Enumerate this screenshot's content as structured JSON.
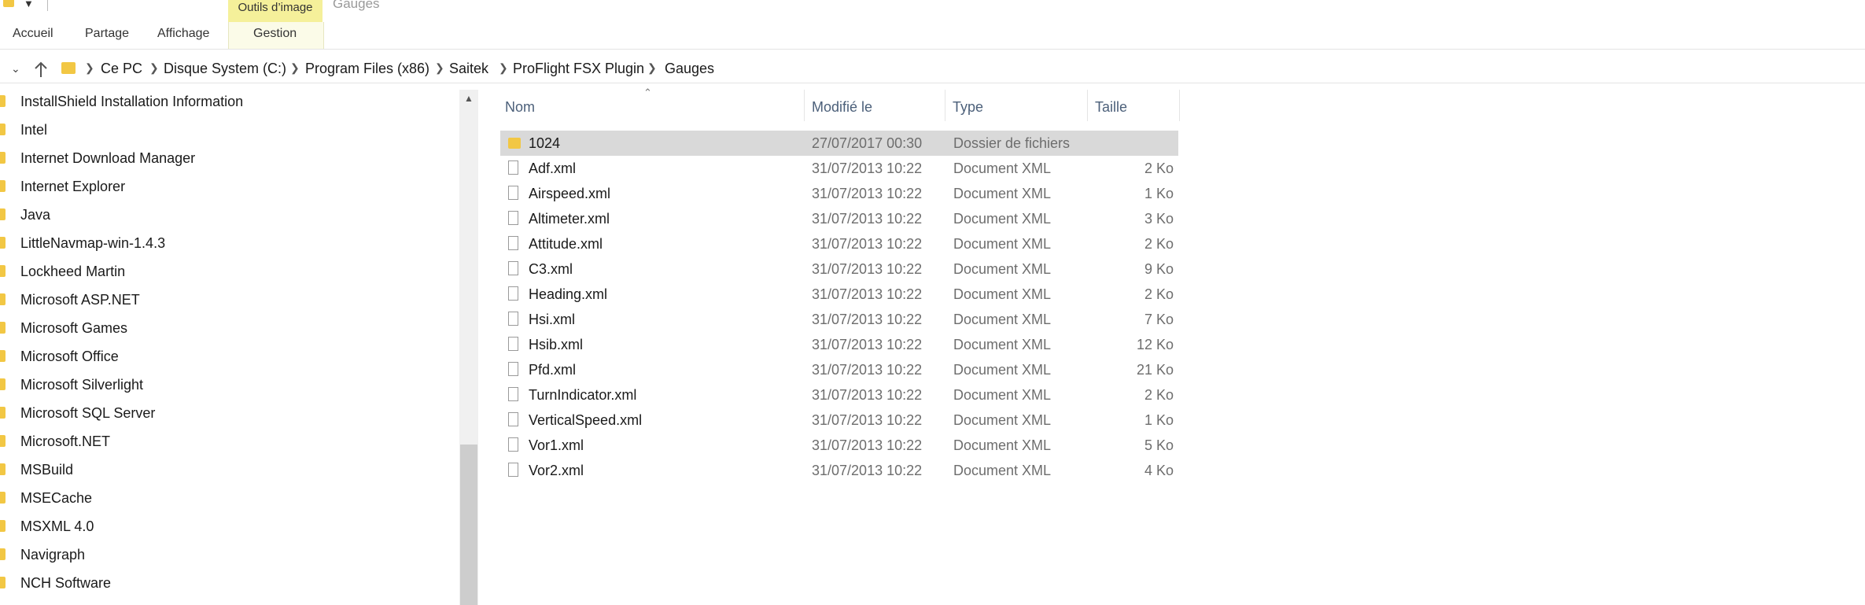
{
  "ribbon": {
    "context_header": "Outils d’image",
    "app_title": "Gauges",
    "tabs": [
      "Accueil",
      "Partage",
      "Affichage",
      "Gestion"
    ]
  },
  "address": {
    "crumbs": [
      "Ce PC",
      "Disque System (C:)",
      "Program Files (x86)",
      "Saitek",
      "ProFlight FSX Plugin",
      "Gauges"
    ]
  },
  "tree": {
    "items": [
      "InstallShield Installation Information",
      "Intel",
      "Internet Download Manager",
      "Internet Explorer",
      "Java",
      "LittleNavmap-win-1.4.3",
      "Lockheed Martin",
      "Microsoft ASP.NET",
      "Microsoft Games",
      "Microsoft Office",
      "Microsoft Silverlight",
      "Microsoft SQL Server",
      "Microsoft.NET",
      "MSBuild",
      "MSECache",
      "MSXML 4.0",
      "Navigraph",
      "NCH Software"
    ]
  },
  "columns": {
    "name": "Nom",
    "modified": "Modifié le",
    "type": "Type",
    "size": "Taille"
  },
  "files": [
    {
      "name": "1024",
      "modified": "27/07/2017 00:30",
      "type": "Dossier de fichiers",
      "size": "",
      "icon": "folder-icon",
      "selected": true
    },
    {
      "name": "Adf.xml",
      "modified": "31/07/2013 10:22",
      "type": "Document XML",
      "size": "2 Ko",
      "icon": "file-icon"
    },
    {
      "name": "Airspeed.xml",
      "modified": "31/07/2013 10:22",
      "type": "Document XML",
      "size": "1 Ko",
      "icon": "file-icon"
    },
    {
      "name": "Altimeter.xml",
      "modified": "31/07/2013 10:22",
      "type": "Document XML",
      "size": "3 Ko",
      "icon": "file-icon"
    },
    {
      "name": "Attitude.xml",
      "modified": "31/07/2013 10:22",
      "type": "Document XML",
      "size": "2 Ko",
      "icon": "file-icon"
    },
    {
      "name": "C3.xml",
      "modified": "31/07/2013 10:22",
      "type": "Document XML",
      "size": "9 Ko",
      "icon": "file-icon"
    },
    {
      "name": "Heading.xml",
      "modified": "31/07/2013 10:22",
      "type": "Document XML",
      "size": "2 Ko",
      "icon": "file-icon"
    },
    {
      "name": "Hsi.xml",
      "modified": "31/07/2013 10:22",
      "type": "Document XML",
      "size": "7 Ko",
      "icon": "file-icon"
    },
    {
      "name": "Hsib.xml",
      "modified": "31/07/2013 10:22",
      "type": "Document XML",
      "size": "12 Ko",
      "icon": "file-icon"
    },
    {
      "name": "Pfd.xml",
      "modified": "31/07/2013 10:22",
      "type": "Document XML",
      "size": "21 Ko",
      "icon": "file-icon"
    },
    {
      "name": "TurnIndicator.xml",
      "modified": "31/07/2013 10:22",
      "type": "Document XML",
      "size": "2 Ko",
      "icon": "file-icon"
    },
    {
      "name": "VerticalSpeed.xml",
      "modified": "31/07/2013 10:22",
      "type": "Document XML",
      "size": "1 Ko",
      "icon": "file-icon"
    },
    {
      "name": "Vor1.xml",
      "modified": "31/07/2013 10:22",
      "type": "Document XML",
      "size": "5 Ko",
      "icon": "file-icon"
    },
    {
      "name": "Vor2.xml",
      "modified": "31/07/2013 10:22",
      "type": "Document XML",
      "size": "4 Ko",
      "icon": "file-icon"
    }
  ],
  "colors": {
    "folder": "#f2c744",
    "selection": "#d9d9d9",
    "context_tab": "#f5f09a",
    "header_text": "#4c607a"
  }
}
